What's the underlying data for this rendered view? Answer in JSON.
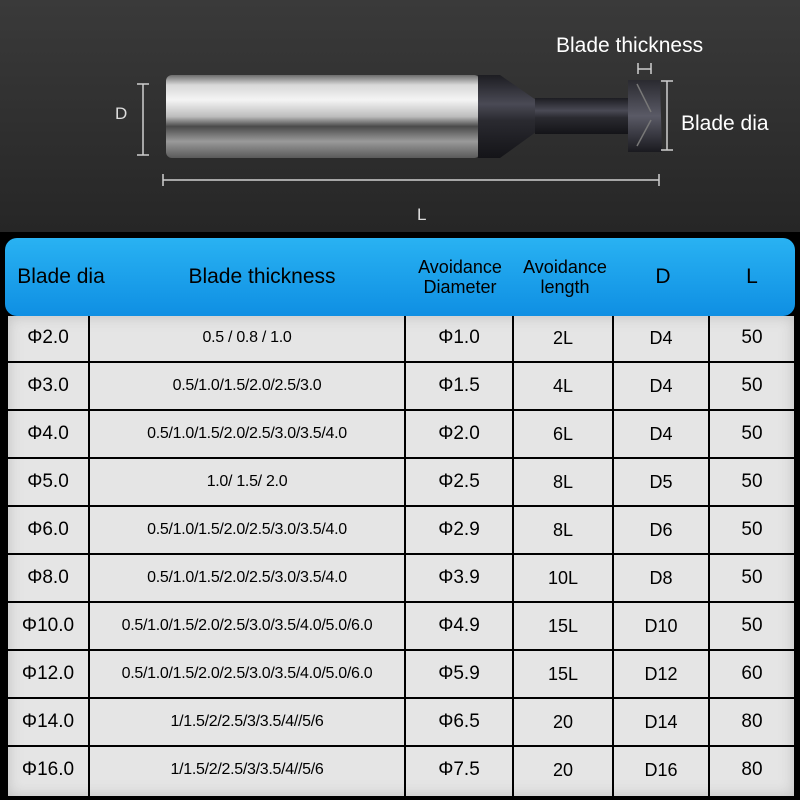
{
  "diagram": {
    "blade_thickness_label": "Blade thickness",
    "blade_dia_label": "Blade dia",
    "d_label": "D",
    "l_label": "L"
  },
  "table": {
    "headers": {
      "blade_dia": "Blade dia",
      "blade_thickness": "Blade thickness",
      "avoidance_diameter_line1": "Avoidance",
      "avoidance_diameter_line2": "Diameter",
      "avoidance_length_line1": "Avoidance",
      "avoidance_length_line2": "length",
      "d": "D",
      "l": "L"
    },
    "rows": [
      {
        "blade_dia": "Φ2.0",
        "blade_thickness": "0.5 / 0.8 / 1.0",
        "avoidance_diameter": "Φ1.0",
        "avoidance_length": "2L",
        "d": "D4",
        "l": "50"
      },
      {
        "blade_dia": "Φ3.0",
        "blade_thickness": "0.5/1.0/1.5/2.0/2.5/3.0",
        "avoidance_diameter": "Φ1.5",
        "avoidance_length": "4L",
        "d": "D4",
        "l": "50"
      },
      {
        "blade_dia": "Φ4.0",
        "blade_thickness": "0.5/1.0/1.5/2.0/2.5/3.0/3.5/4.0",
        "avoidance_diameter": "Φ2.0",
        "avoidance_length": "6L",
        "d": "D4",
        "l": "50"
      },
      {
        "blade_dia": "Φ5.0",
        "blade_thickness": "1.0/ 1.5/ 2.0",
        "avoidance_diameter": "Φ2.5",
        "avoidance_length": "8L",
        "d": "D5",
        "l": "50"
      },
      {
        "blade_dia": "Φ6.0",
        "blade_thickness": "0.5/1.0/1.5/2.0/2.5/3.0/3.5/4.0",
        "avoidance_diameter": "Φ2.9",
        "avoidance_length": "8L",
        "d": "D6",
        "l": "50"
      },
      {
        "blade_dia": "Φ8.0",
        "blade_thickness": "0.5/1.0/1.5/2.0/2.5/3.0/3.5/4.0",
        "avoidance_diameter": "Φ3.9",
        "avoidance_length": "10L",
        "d": "D8",
        "l": "50"
      },
      {
        "blade_dia": "Φ10.0",
        "blade_thickness": "0.5/1.0/1.5/2.0/2.5/3.0/3.5/4.0/5.0/6.0",
        "avoidance_diameter": "Φ4.9",
        "avoidance_length": "15L",
        "d": "D10",
        "l": "50"
      },
      {
        "blade_dia": "Φ12.0",
        "blade_thickness": "0.5/1.0/1.5/2.0/2.5/3.0/3.5/4.0/5.0/6.0",
        "avoidance_diameter": "Φ5.9",
        "avoidance_length": "15L",
        "d": "D12",
        "l": "60"
      },
      {
        "blade_dia": "Φ14.0",
        "blade_thickness": "1/1.5/2/2.5/3/3.5/4//5/6",
        "avoidance_diameter": "Φ6.5",
        "avoidance_length": "20",
        "d": "D14",
        "l": "80"
      },
      {
        "blade_dia": "Φ16.0",
        "blade_thickness": "1/1.5/2/2.5/3/3.5/4//5/6",
        "avoidance_diameter": "Φ7.5",
        "avoidance_length": "20",
        "d": "D16",
        "l": "80"
      }
    ]
  }
}
